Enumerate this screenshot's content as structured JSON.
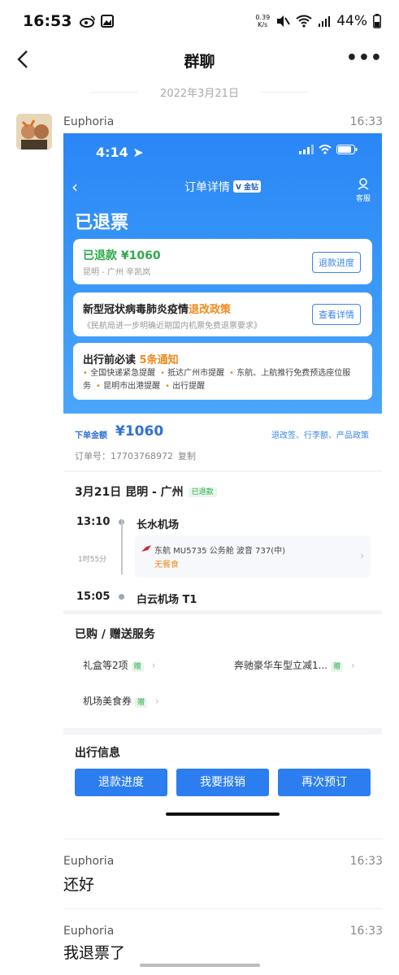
{
  "status_bar": {
    "time": "16:53",
    "net_speed_value": "0.39",
    "net_speed_unit": "K/s",
    "battery": "44%"
  },
  "nav": {
    "title": "群聊"
  },
  "date_divider": "2022年3月21日",
  "messages": [
    {
      "sender": "Euphoria",
      "time": "16:33",
      "type": "image",
      "screenshot": {
        "status_time": "4:14",
        "header_title": "订单详情",
        "header_badge": "V 金钻",
        "service_label": "客服",
        "order_status": "已退票",
        "refund_card": {
          "title": "已退款 ¥1060",
          "sub": "昆明 - 广州 辛凯岚",
          "button": "退款进度"
        },
        "covid_card": {
          "title_prefix": "新型冠状病毒肺炎疫情",
          "title_highlight": "退改政策",
          "sub": "《民航局进一步明确近期国内机票免费退票要求》",
          "button": "查看详情"
        },
        "notice_card": {
          "title_prefix": "出行前必读",
          "title_highlight": "5条通知",
          "items": [
            "全国快递紧急提醒",
            "抵达广州市提醒",
            "东航、上航推行免费预选座位服务",
            "昆明市出港提醒",
            "出行提醒"
          ]
        },
        "order": {
          "amount_label": "下单金额",
          "amount": "¥1060",
          "policy_link": "退改签、行李额、产品政策",
          "order_no": "订单号：17703768972",
          "copy_label": "复制"
        },
        "flight": {
          "heading": "3月21日 昆明 - 广州",
          "status_tag": "已退款",
          "dep_time": "13:10",
          "dep_airport": "长水机场",
          "duration": "1时55分",
          "airline_info": "东航 MU5735  公务舱  波音 737(中)",
          "meal": "无餐食",
          "arr_time": "15:05",
          "arr_airport": "白云机场 T1"
        },
        "services": {
          "heading": "已购 / 赠送服务",
          "items": [
            {
              "label": "礼盒等2项",
              "tag": "赠"
            },
            {
              "label": "奔驰豪华车型立减1...",
              "tag": "赠"
            },
            {
              "label": "机场美食券",
              "tag": "赠"
            }
          ]
        },
        "travel": {
          "heading": "出行信息",
          "buttons": [
            "退款进度",
            "我要报销",
            "再次预订"
          ]
        }
      }
    },
    {
      "sender": "Euphoria",
      "time": "16:33",
      "type": "text",
      "text": "还好"
    },
    {
      "sender": "Euphoria",
      "time": "16:33",
      "type": "text",
      "text": "我退票了"
    }
  ]
}
